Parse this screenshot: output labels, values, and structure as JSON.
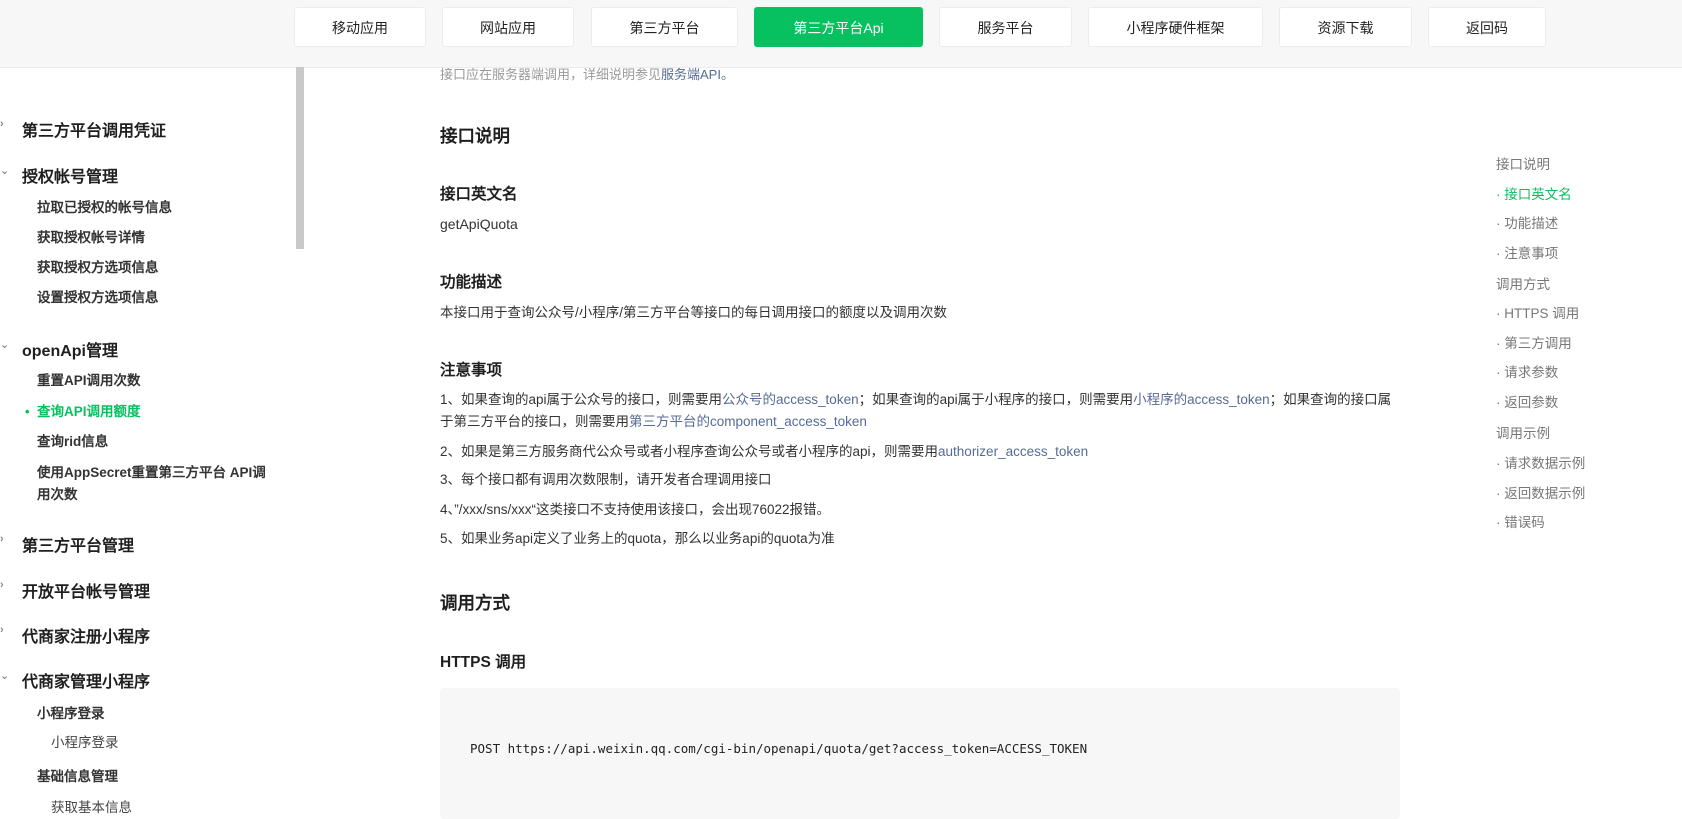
{
  "topnav": {
    "items": [
      {
        "label": "移动应用"
      },
      {
        "label": "网站应用"
      },
      {
        "label": "第三方平台"
      },
      {
        "label": "第三方平台Api"
      },
      {
        "label": "服务平台"
      },
      {
        "label": "小程序硬件框架"
      },
      {
        "label": "资源下载"
      },
      {
        "label": "返回码"
      }
    ]
  },
  "sidebar": {
    "groups": [
      {
        "label": "第三方平台调用凭证",
        "icon": "chevron-right-icon"
      },
      {
        "label": "授权帐号管理",
        "icon": "chevron-down-icon"
      },
      {
        "label": "openApi管理",
        "icon": "chevron-down-icon"
      },
      {
        "label": "第三方平台管理",
        "icon": "chevron-right-icon"
      },
      {
        "label": "开放平台帐号管理",
        "icon": "chevron-right-icon"
      },
      {
        "label": "代商家注册小程序",
        "icon": "chevron-right-icon"
      },
      {
        "label": "代商家管理小程序",
        "icon": "chevron-down-icon"
      }
    ],
    "auth_items": [
      "拉取已授权的帐号信息",
      "获取授权帐号详情",
      "获取授权方选项信息",
      "设置授权方选项信息"
    ],
    "openapi_items": [
      "重置API调用次数",
      "查询API调用额度",
      "查询rid信息",
      "使用AppSecret重置第三方平台 API调用次数"
    ],
    "mp_items": [
      {
        "label": "小程序登录",
        "sub": "小程序登录"
      },
      {
        "label": "基础信息管理",
        "sub": "获取基本信息"
      }
    ]
  },
  "main": {
    "hint_text": "接口应在服务器端调用，详细说明参见",
    "hint_link": "服务端API。",
    "sections": {
      "interface_desc": "接口说明",
      "english_name_title": "接口英文名",
      "english_name": "getApiQuota",
      "func_title": "功能描述",
      "func_text": "本接口用于查询公众号/小程序/第三方平台等接口的每日调用接口的额度以及调用次数",
      "notes_title": "注意事项",
      "call_title": "调用方式",
      "https_title": "HTTPS 调用"
    },
    "notes": {
      "n1_a": "1、如果查询的api属于公众号的接口，则需要用",
      "n1_link1": "公众号的access_token",
      "n1_b": "；如果查询的api属于小程序的接口，则需要用",
      "n1_link2": "小程序的access_token",
      "n1_c": "；如果查询的接口属于第三方平台的接口，则需要用",
      "n1_link3": "第三方平台的component_access_token",
      "n2_a": "2、如果是第三方服务商代公众号或者小程序查询公众号或者小程序的api，则需要用",
      "n2_link": "authorizer_access_token",
      "n3": "3、每个接口都有调用次数限制，请开发者合理调用接口",
      "n4": "4、”/xxx/sns/xxx“这类接口不支持使用该接口，会出现76022报错。",
      "n5": "5、如果业务api定义了业务上的quota，那么以业务api的quota为准"
    },
    "code": "POST https://api.weixin.qq.com/cgi-bin/openapi/quota/get?access_token=ACCESS_TOKEN"
  },
  "toc": {
    "items": [
      {
        "label": "接口说明"
      },
      {
        "label": "· 接口英文名"
      },
      {
        "label": "· 功能描述"
      },
      {
        "label": "· 注意事项"
      },
      {
        "label": "调用方式"
      },
      {
        "label": "· HTTPS 调用"
      },
      {
        "label": "· 第三方调用"
      },
      {
        "label": "· 请求参数"
      },
      {
        "label": "· 返回参数"
      },
      {
        "label": "调用示例"
      },
      {
        "label": "· 请求数据示例"
      },
      {
        "label": "· 返回数据示例"
      },
      {
        "label": "· 错误码"
      }
    ],
    "active_color": "#07c160"
  },
  "colors": {
    "accent": "#07c160",
    "link": "#576b95"
  }
}
